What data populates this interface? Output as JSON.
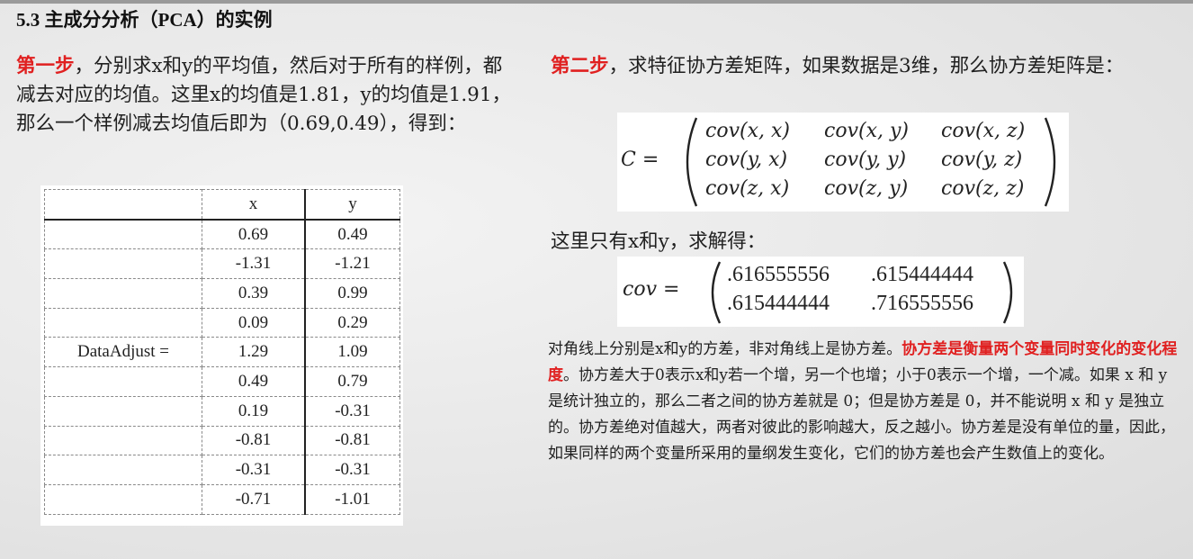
{
  "title": "5.3 主成分分析（PCA）的实例",
  "step1": {
    "label": "第一步",
    "text": "，分别求x和y的平均值，然后对于所有的样例，都减去对应的均值。这里x的均值是1.81，y的均值是1.91，那么一个样例减去均值后即为（0.69,0.49），得到："
  },
  "table": {
    "headers": [
      "",
      "x",
      "y"
    ],
    "row_label": "DataAdjust  =",
    "rows": [
      [
        "0.69",
        "0.49"
      ],
      [
        "-1.31",
        "-1.21"
      ],
      [
        "0.39",
        "0.99"
      ],
      [
        "0.09",
        "0.29"
      ],
      [
        "1.29",
        "1.09"
      ],
      [
        "0.49",
        "0.79"
      ],
      [
        "0.19",
        "-0.31"
      ],
      [
        "-0.81",
        "-0.81"
      ],
      [
        "-0.31",
        "-0.31"
      ],
      [
        "-0.71",
        "-1.01"
      ]
    ]
  },
  "step2": {
    "label": "第二步",
    "text": "，求特征协方差矩阵，如果数据是3维，那么协方差矩阵是："
  },
  "cov_matrix": {
    "lhs": "C =",
    "rows": [
      [
        "cov(x, x)",
        "cov(x, y)",
        "cov(x, z)"
      ],
      [
        "cov(y, x)",
        "cov(y, y)",
        "cov(y, z)"
      ],
      [
        "cov(z, x)",
        "cov(z, y)",
        "cov(z, z)"
      ]
    ]
  },
  "only_xy": "这里只有x和y，求解得：",
  "cov_result": {
    "lhs": "cov =",
    "rows": [
      [
        ".616555556",
        ".615444444"
      ],
      [
        ".615444444",
        ".716555556"
      ]
    ]
  },
  "explanation": {
    "pre": "对角线上分别是x和y的方差，非对角线上是协方差。",
    "highlight": "协方差是衡量两个变量同时变化的变化程度",
    "post": "。协方差大于0表示x和y若一个增，另一个也增；小于0表示一个增，一个减。如果 x 和 y 是统计独立的，那么二者之间的协方差就是 0；但是协方差是 0，并不能说明 x 和 y 是独立的。协方差绝对值越大，两者对彼此的影响越大，反之越小。协方差是没有单位的量，因此，如果同样的两个变量所采用的量纲发生变化，它们的协方差也会产生数值上的变化。"
  }
}
